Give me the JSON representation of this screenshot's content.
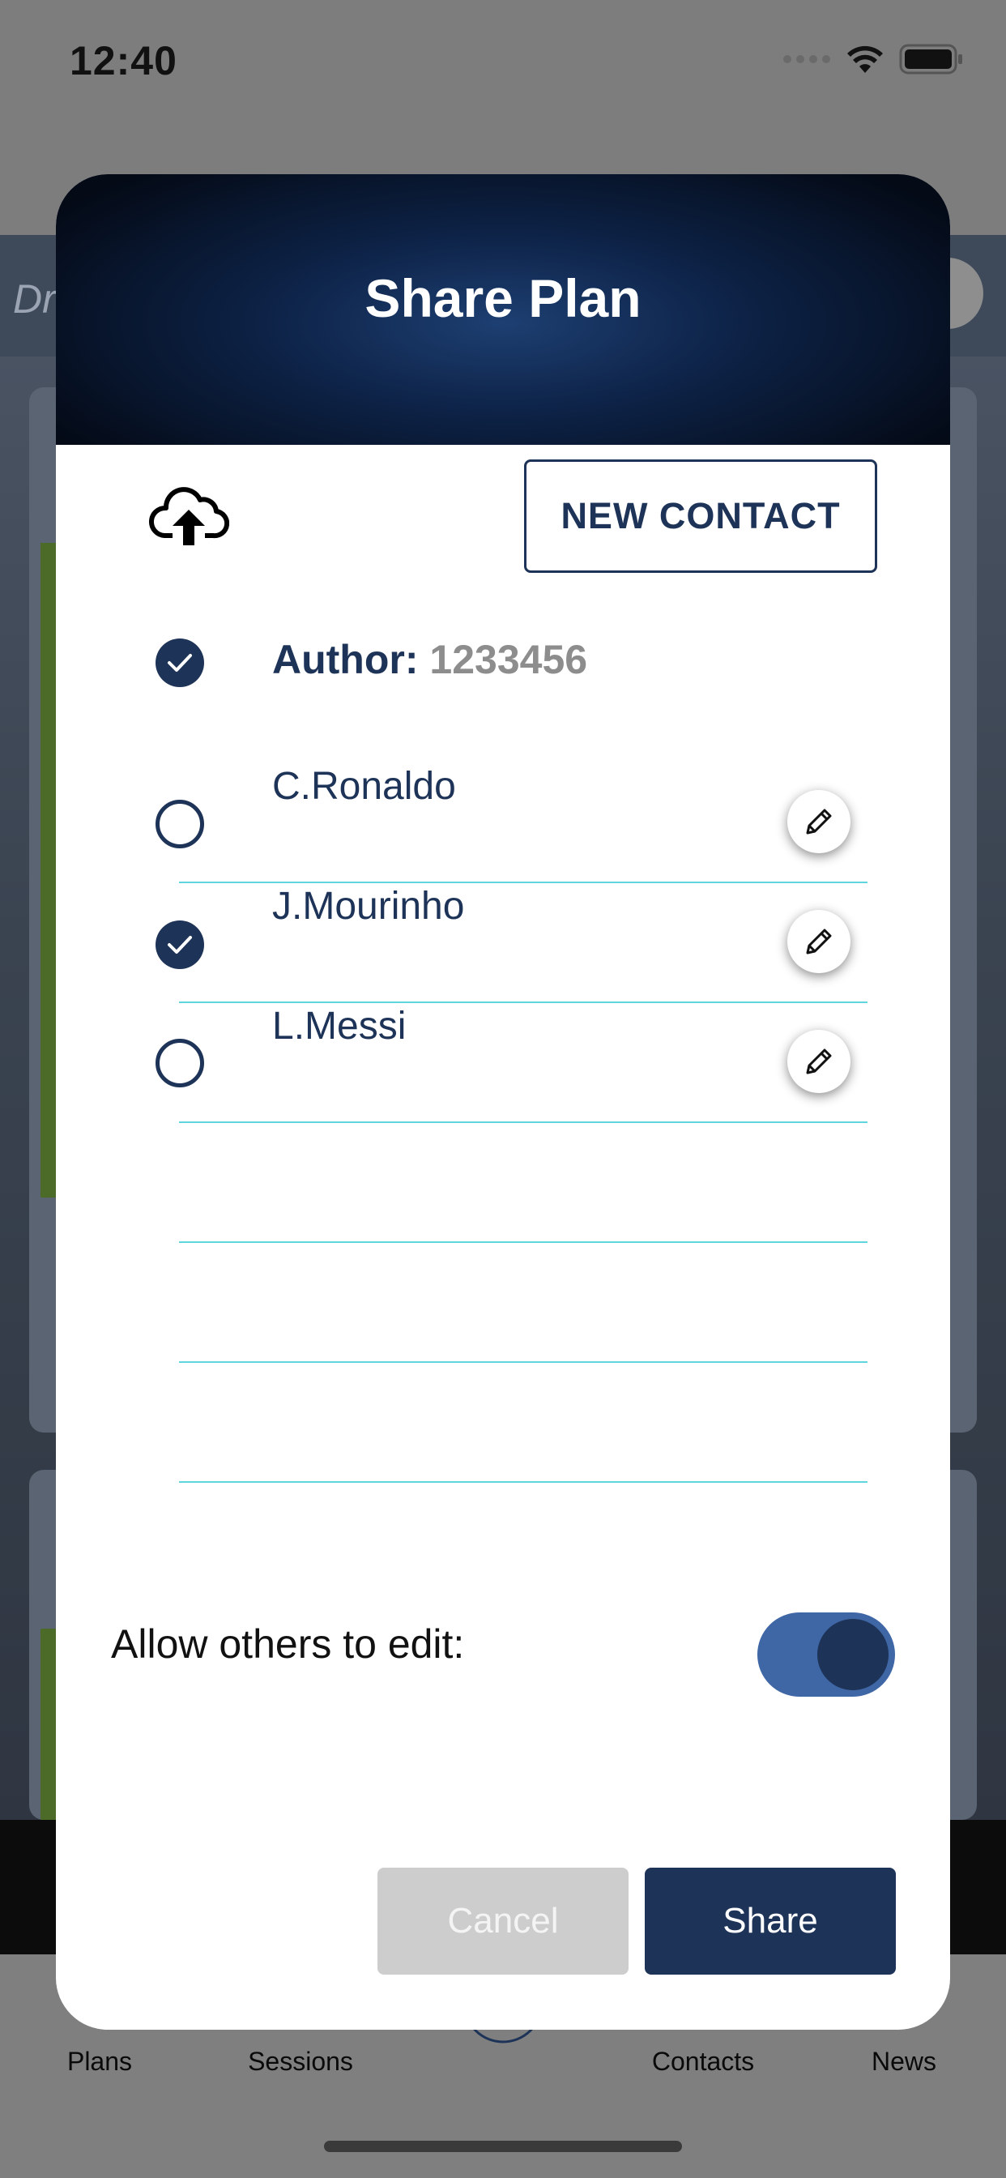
{
  "status_bar": {
    "time": "12:40"
  },
  "background": {
    "header_text": "Dr",
    "tabs": [
      {
        "label": "Plans"
      },
      {
        "label": "Sessions"
      },
      {
        "label": ""
      },
      {
        "label": "Contacts"
      },
      {
        "label": "News"
      }
    ]
  },
  "modal": {
    "title": "Share Plan",
    "new_contact_label": "NEW CONTACT",
    "author": {
      "label": "Author:",
      "id": "1233456",
      "checked": true
    },
    "contacts": [
      {
        "name": "C.Ronaldo",
        "checked": false
      },
      {
        "name": "J.Mourinho",
        "checked": true
      },
      {
        "name": "L.Messi",
        "checked": false
      }
    ],
    "allow_edit_label": "Allow others to edit:",
    "allow_edit_enabled": true,
    "cancel_label": "Cancel",
    "share_label": "Share"
  },
  "colors": {
    "primary": "#1d3357",
    "toggle_track": "#3f67a6",
    "row_divider": "#5fd6de",
    "cancel_bg": "#cdcdcd"
  }
}
